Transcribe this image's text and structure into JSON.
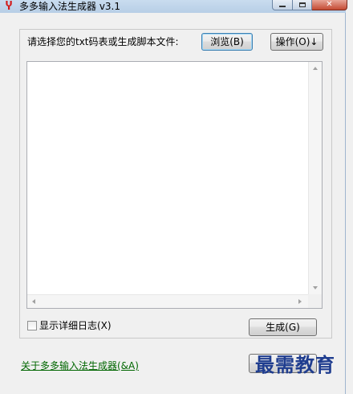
{
  "window": {
    "title": "多多输入法生成器 v3.1",
    "icon": "app-logo-icon"
  },
  "controls": {
    "minimize_icon": "minimize-icon",
    "maximize_icon": "maximize-icon",
    "close_icon": "close-icon"
  },
  "main": {
    "prompt_label": "请选择您的txt码表或生成脚本文件:",
    "browse_button": "浏览(B)",
    "operation_button": "操作(O)↓",
    "log_text": "",
    "detail_log_label": "显示详细日志(X)",
    "detail_log_checked": false,
    "generate_button": "生成(G)"
  },
  "footer": {
    "about_link": "关于多多输入法生成器(&A)",
    "watermark": "最需教育"
  },
  "colors": {
    "link": "#006600",
    "titlebar": "#b7cee6",
    "close": "#c44a33"
  }
}
